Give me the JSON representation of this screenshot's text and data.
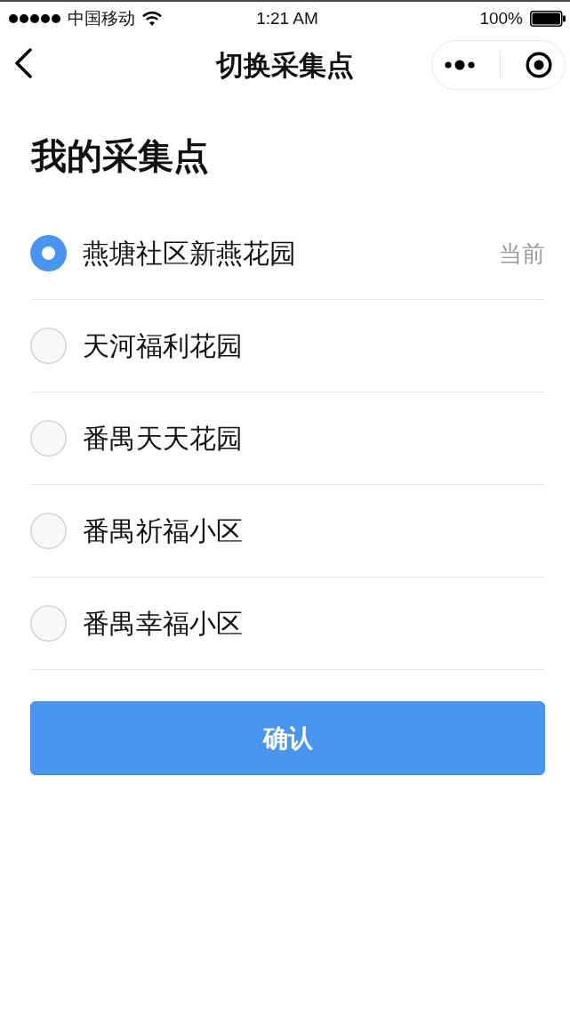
{
  "status_bar": {
    "carrier": "中国移动",
    "time": "1:21 AM",
    "battery": "100%"
  },
  "nav_bar": {
    "title": "切换采集点"
  },
  "heading": "我的采集点",
  "sites": [
    {
      "name": "燕塘社区新燕花园",
      "selected": true,
      "tag": "当前"
    },
    {
      "name": "天河福利花园",
      "selected": false
    },
    {
      "name": "番禺天天花园",
      "selected": false
    },
    {
      "name": "番禺祈福小区",
      "selected": false
    },
    {
      "name": "番禺幸福小区",
      "selected": false
    }
  ],
  "confirm_button": "确认"
}
